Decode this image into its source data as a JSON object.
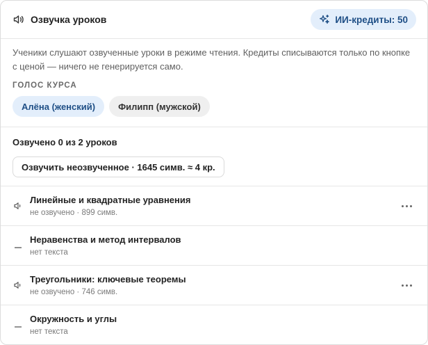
{
  "header": {
    "title": "Озвучка уроков",
    "credits_label": "ИИ-кредиты: 50"
  },
  "intro": {
    "text": "Ученики слушают озвученные уроки в режиме чтения. Кредиты списываются только по кнопке с ценой — ничего не генерируется само.",
    "voice_section_label": "ГОЛОС КУРСА",
    "voices": [
      {
        "label": "Алёна (женский)",
        "selected": true
      },
      {
        "label": "Филипп (мужской)",
        "selected": false
      }
    ]
  },
  "progress": {
    "text": "Озвучено 0 из 2 уроков",
    "voice_all_button": "Озвучить неозвученное · 1645 симв. ≈ 4 кр."
  },
  "lessons": [
    {
      "title": "Линейные и квадратные уравнения",
      "status": "не озвучено · 899 симв.",
      "icon": "speaker-icon",
      "has_menu": true
    },
    {
      "title": "Неравенства и метод интервалов",
      "status": "нет текста",
      "icon": "dash-icon",
      "has_menu": false
    },
    {
      "title": "Треугольники: ключевые теоремы",
      "status": "не озвучено · 746 симв.",
      "icon": "speaker-icon",
      "has_menu": true
    },
    {
      "title": "Окружность и углы",
      "status": "нет текста",
      "icon": "dash-icon",
      "has_menu": false
    }
  ],
  "colors": {
    "accent_bg": "#e3eefb",
    "accent_text": "#1f4f86",
    "border": "#e6e6e6"
  }
}
